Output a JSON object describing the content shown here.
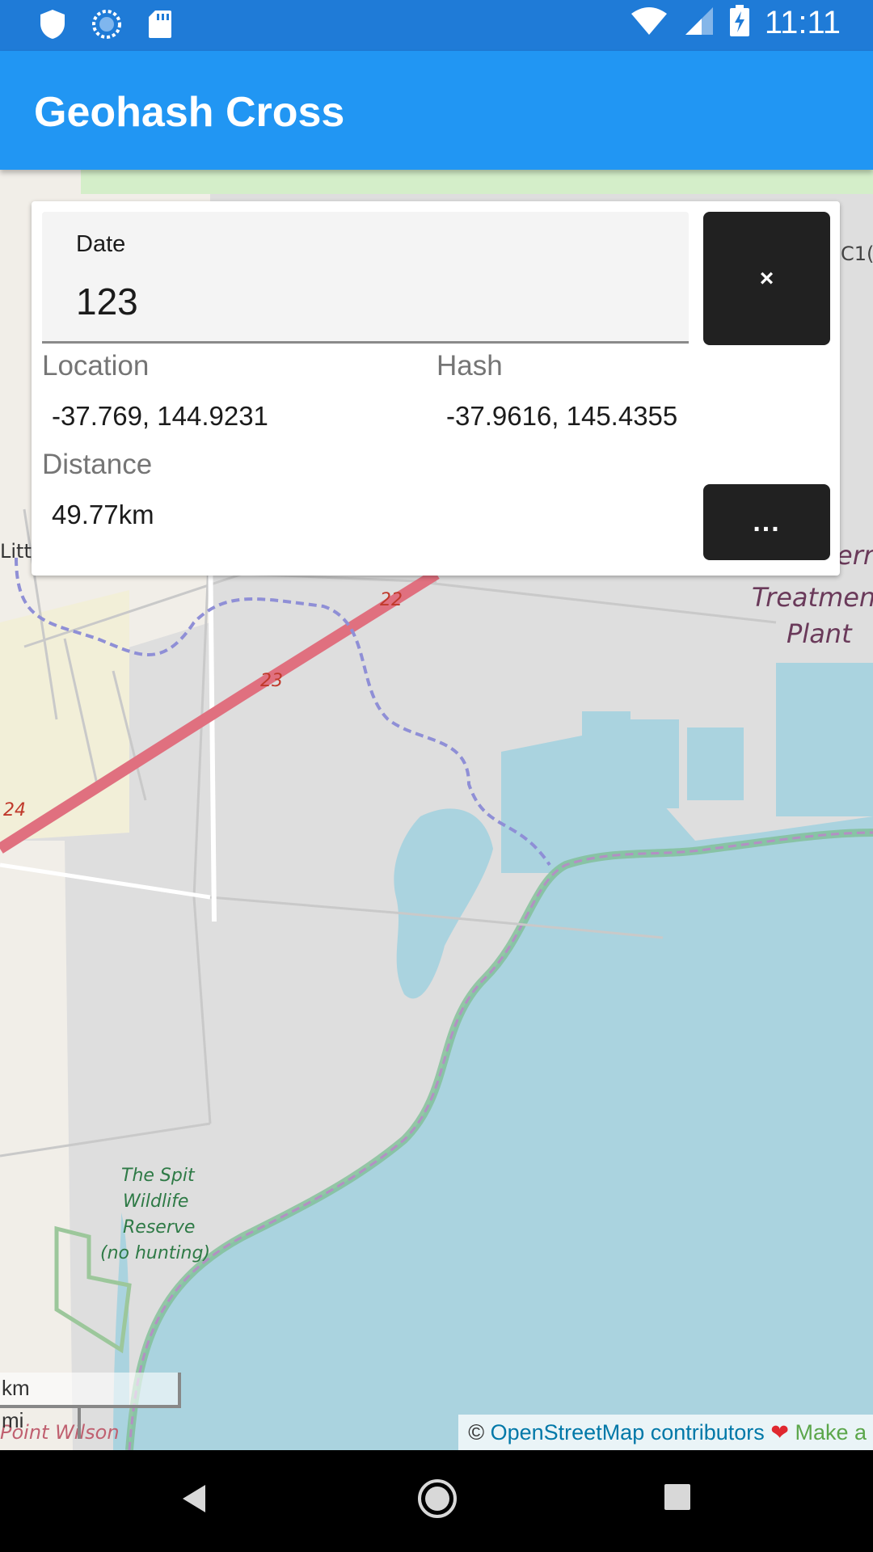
{
  "status_bar": {
    "time": "11:11",
    "left_icons": [
      "shield-icon",
      "sync-icon",
      "sd-card-icon"
    ],
    "right_icons": [
      "wifi-icon",
      "signal-icon",
      "battery-charging-icon"
    ]
  },
  "app_bar": {
    "title": "Geohash Cross"
  },
  "card": {
    "date_label": "Date",
    "date_value": "123",
    "close_label": "×",
    "location_label": "Location",
    "location_value": "-37.769, 144.9231",
    "hash_label": "Hash",
    "hash_value": "-37.9616, 145.4355",
    "distance_label": "Distance",
    "distance_value": "49.77km",
    "more_label": "..."
  },
  "map": {
    "labels": {
      "road_22": "22",
      "road_23": "23",
      "road_24": "24",
      "road_c1": "C1(",
      "litt": "Litt",
      "treatment_1": "err",
      "treatment_2": "Treatmen",
      "treatment_3": "Plant",
      "spit_1": "The Spit",
      "spit_2": "Wildlife",
      "spit_3": "Reserve",
      "spit_4": "(no hunting)",
      "point_wilson": "Point Wilson"
    },
    "scale": {
      "km": "km",
      "mi": "mi"
    },
    "attribution": {
      "copyright": "©",
      "link": "OpenStreetMap contributors",
      "heart": "❤",
      "make": "Make a"
    },
    "colors": {
      "water": "#aad3df",
      "land": "#dedede",
      "park_edge": "#7fbf96",
      "road": "#e0707f"
    }
  },
  "nav_bar": {
    "icons": [
      "back-icon",
      "home-icon",
      "recents-icon"
    ]
  }
}
